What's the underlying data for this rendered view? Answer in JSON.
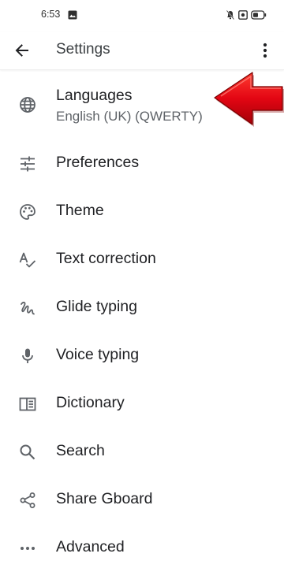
{
  "status_bar": {
    "time": "6:53"
  },
  "app_bar": {
    "title": "Settings"
  },
  "menu": [
    {
      "label": "Languages",
      "sublabel": "English (UK) (QWERTY)",
      "icon": "globe-icon"
    },
    {
      "label": "Preferences",
      "icon": "sliders-icon"
    },
    {
      "label": "Theme",
      "icon": "palette-icon"
    },
    {
      "label": "Text correction",
      "icon": "spellcheck-icon"
    },
    {
      "label": "Glide typing",
      "icon": "gesture-icon"
    },
    {
      "label": "Voice typing",
      "icon": "microphone-icon"
    },
    {
      "label": "Dictionary",
      "icon": "book-icon"
    },
    {
      "label": "Search",
      "icon": "search-icon"
    },
    {
      "label": "Share Gboard",
      "icon": "share-icon"
    },
    {
      "label": "Advanced",
      "icon": "more-horizontal-icon"
    }
  ],
  "colors": {
    "icon": "#5f6368",
    "arrow": "#e30613"
  }
}
